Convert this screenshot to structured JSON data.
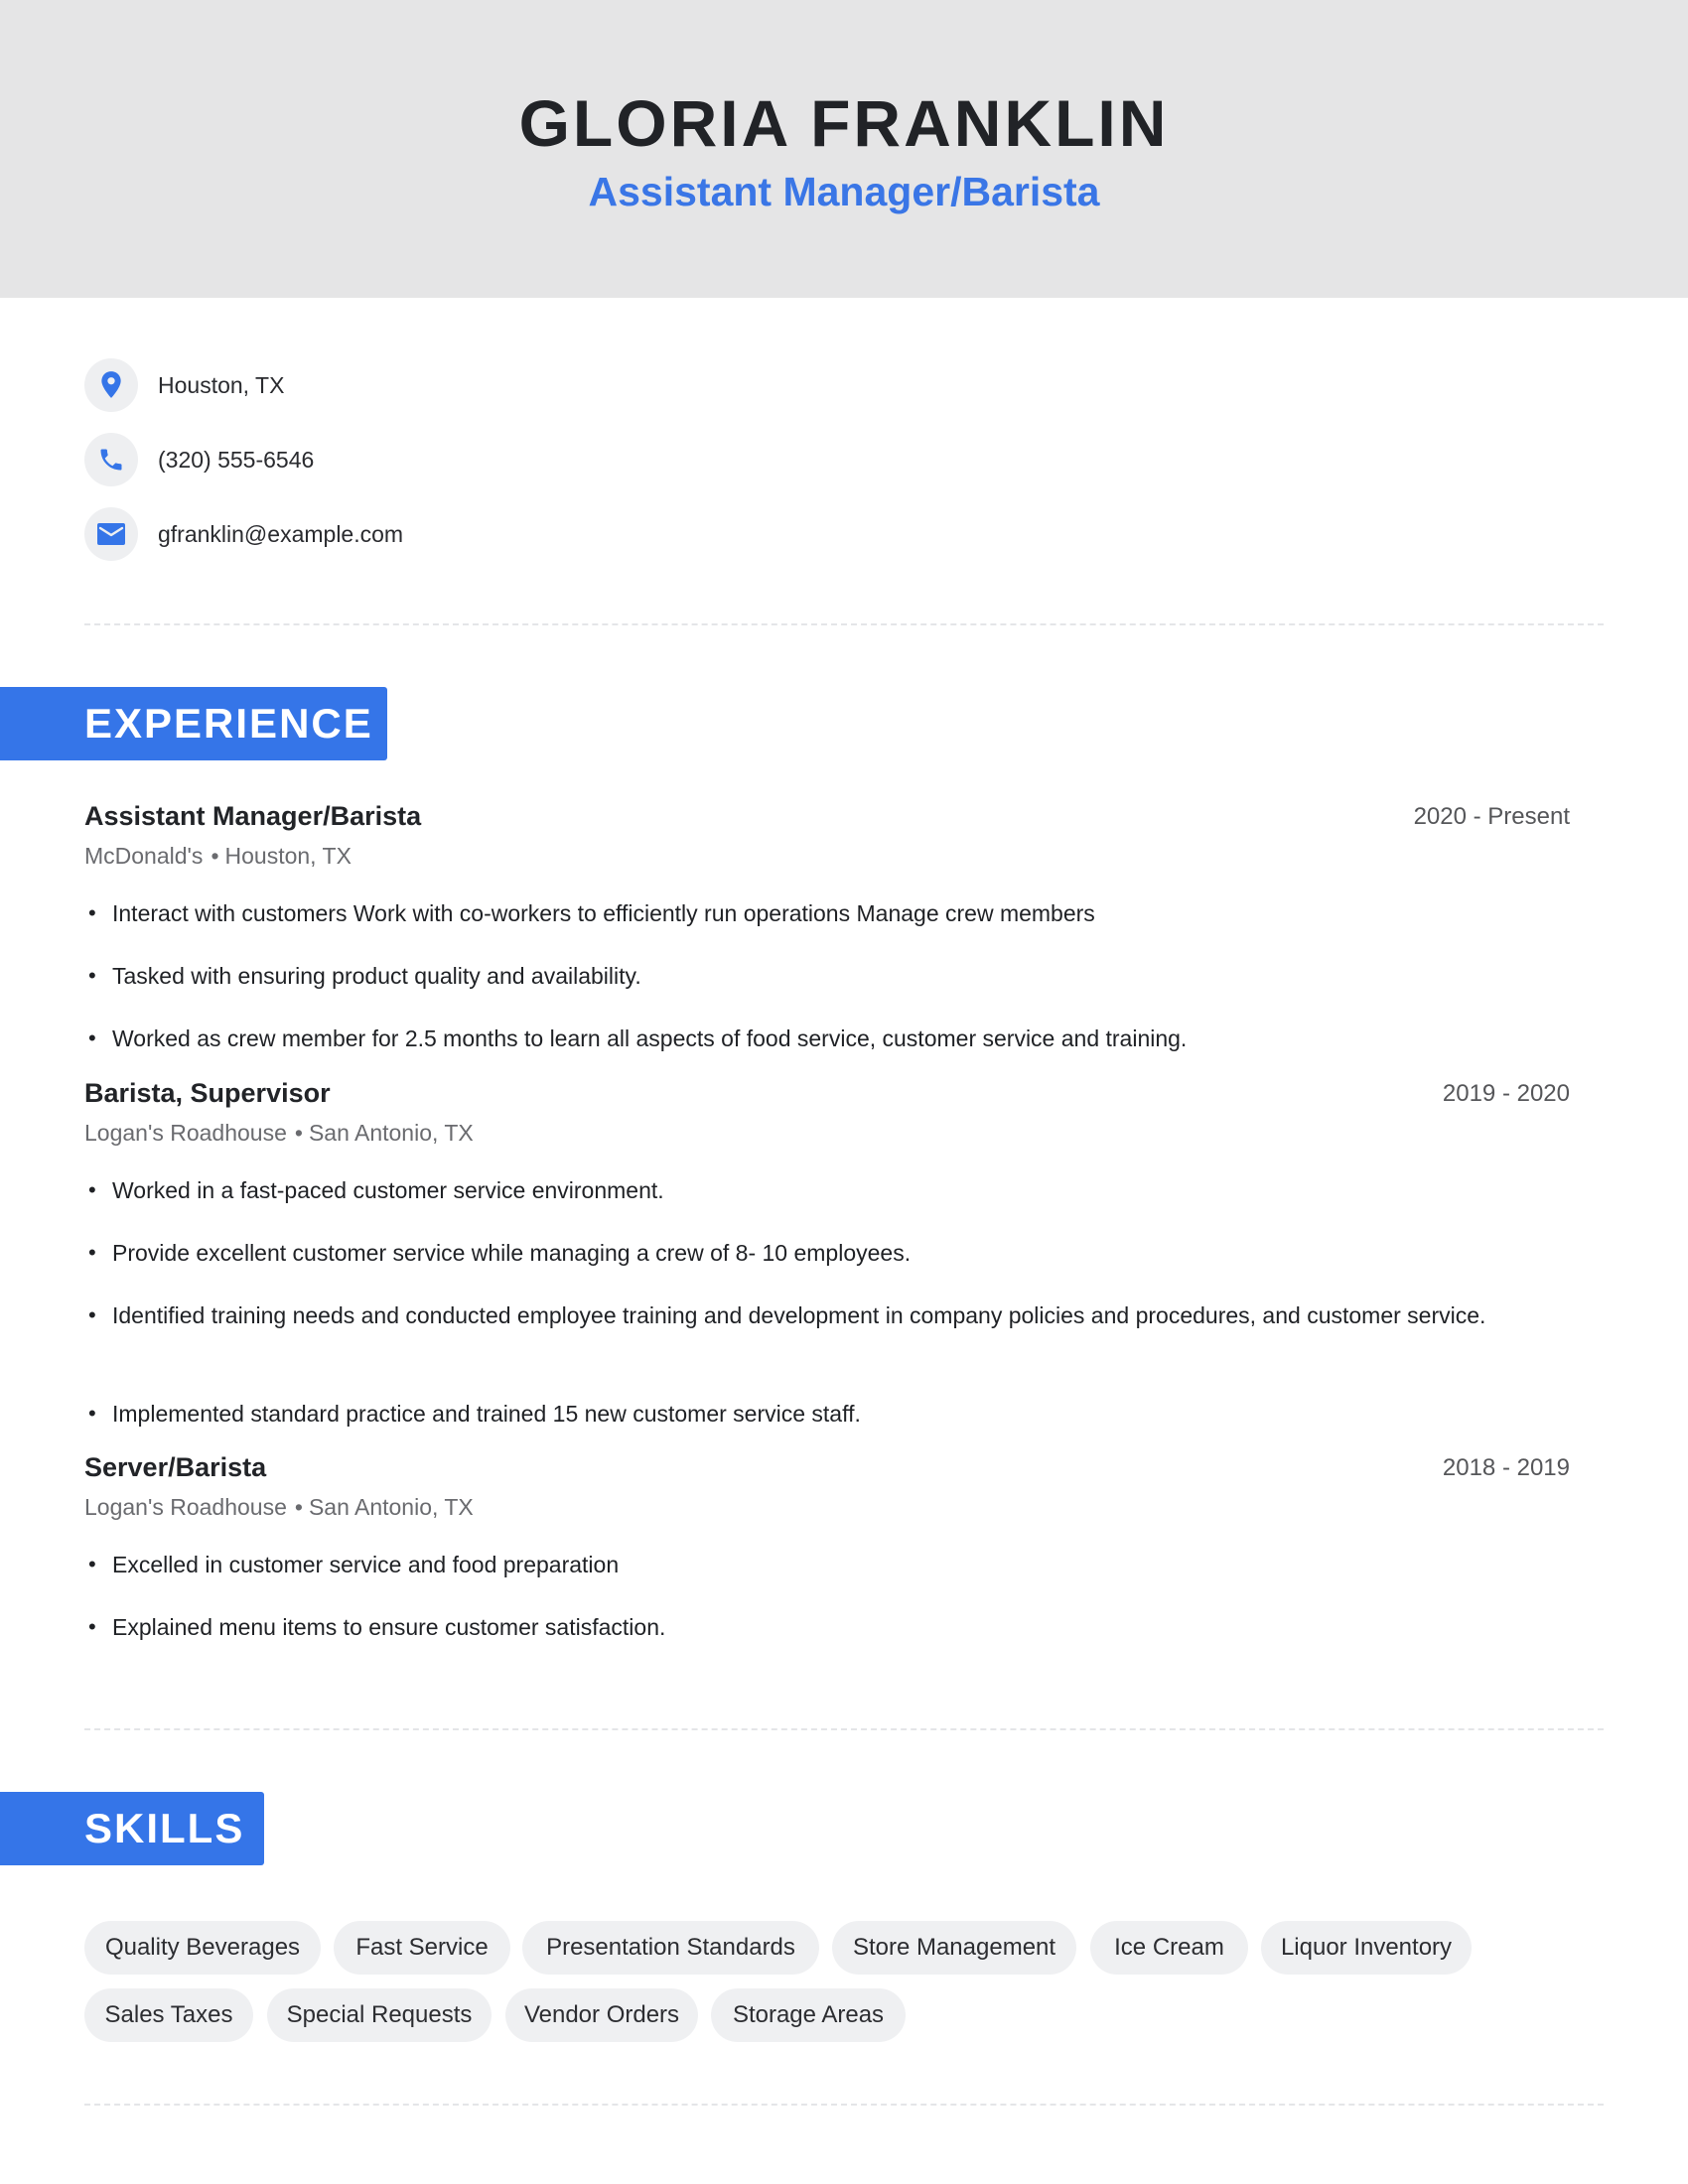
{
  "header": {
    "name": "GLORIA FRANKLIN",
    "headline": "Assistant Manager/Barista"
  },
  "contact": [
    {
      "icon": "location-pin-icon",
      "text": "Houston, TX"
    },
    {
      "icon": "phone-icon",
      "text": "(320) 555-6546"
    },
    {
      "icon": "email-icon",
      "text": "gfranklin@example.com"
    }
  ],
  "colors": {
    "accent": "#3575e8",
    "header_bg": "#e5e5e6",
    "pill_bg": "#eff0f2",
    "text": "#1f2125"
  },
  "experience": {
    "heading": "EXPERIENCE",
    "jobs": [
      {
        "title": "Assistant Manager/Barista",
        "dates": "2020 - Present",
        "company": "McDonald's",
        "separator": "•",
        "location": "Houston, TX",
        "bullets": [
          "Interact with customers Work with co-workers to efficiently run operations Manage crew members",
          "Tasked with ensuring product quality and availability.",
          "Worked as crew member for 2.5 months to learn all aspects of food service, customer service and training."
        ]
      },
      {
        "title": "Barista, Supervisor",
        "dates": "2019 - 2020",
        "company": "Logan's Roadhouse",
        "separator": "•",
        "location": "San Antonio, TX",
        "bullets": [
          "Worked in a fast-paced customer service environment.",
          "Provide excellent customer service while managing a crew of 8- 10 employees.",
          "Identified training needs and conducted employee training and development in company policies and procedures, and customer service.",
          "Implemented standard practice and trained 15 new customer service staff."
        ]
      },
      {
        "title": "Server/Barista",
        "dates": "2018 - 2019",
        "company": "Logan's Roadhouse",
        "separator": "•",
        "location": "San Antonio, TX",
        "bullets": [
          "Excelled in customer service and food preparation",
          "Explained menu items to ensure customer satisfaction."
        ]
      }
    ]
  },
  "skills": {
    "heading": "SKILLS",
    "items": [
      "Quality Beverages",
      "Fast Service",
      "Presentation Standards",
      "Store Management",
      "Ice Cream",
      "Liquor Inventory",
      "Sales Taxes",
      "Special Requests",
      "Vendor Orders",
      "Storage Areas"
    ]
  }
}
